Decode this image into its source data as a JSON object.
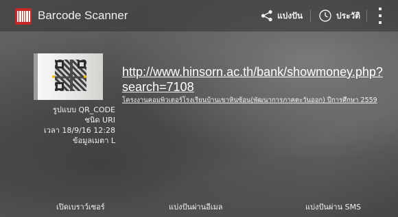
{
  "app": {
    "title": "Barcode Scanner",
    "icon": "barcode-app-icon",
    "accent_color": "#c62828"
  },
  "actions": {
    "share_label": "แบ่งปัน",
    "history_label": "ประวัติ",
    "share_icon": "share-icon",
    "history_icon": "clock-icon",
    "menu_icon": "overflow-menu-icon"
  },
  "result": {
    "url_text": "http://www.hinsorn.ac.th/bank/showmoney.php?search=7108",
    "description": "โครงงานคอมพิวเตอร์โรงเรียนบ้านเขาหินซ้อน(พัฒนาการภาคตะวันออก) ปีการศึกษา 2559",
    "format_line": "รูปแบบ QR_CODE",
    "type_line": "ชนิด URI",
    "time_line": "เวลา 18/9/16 12:28",
    "metadata_line": "ข้อมูลเมตา L"
  },
  "bottom": {
    "open_browser": "เปิดเบราว์เซอร์",
    "share_email": "แบ่งปันผ่านอีเมล",
    "share_sms": "แบ่งปันผ่าน SMS"
  }
}
